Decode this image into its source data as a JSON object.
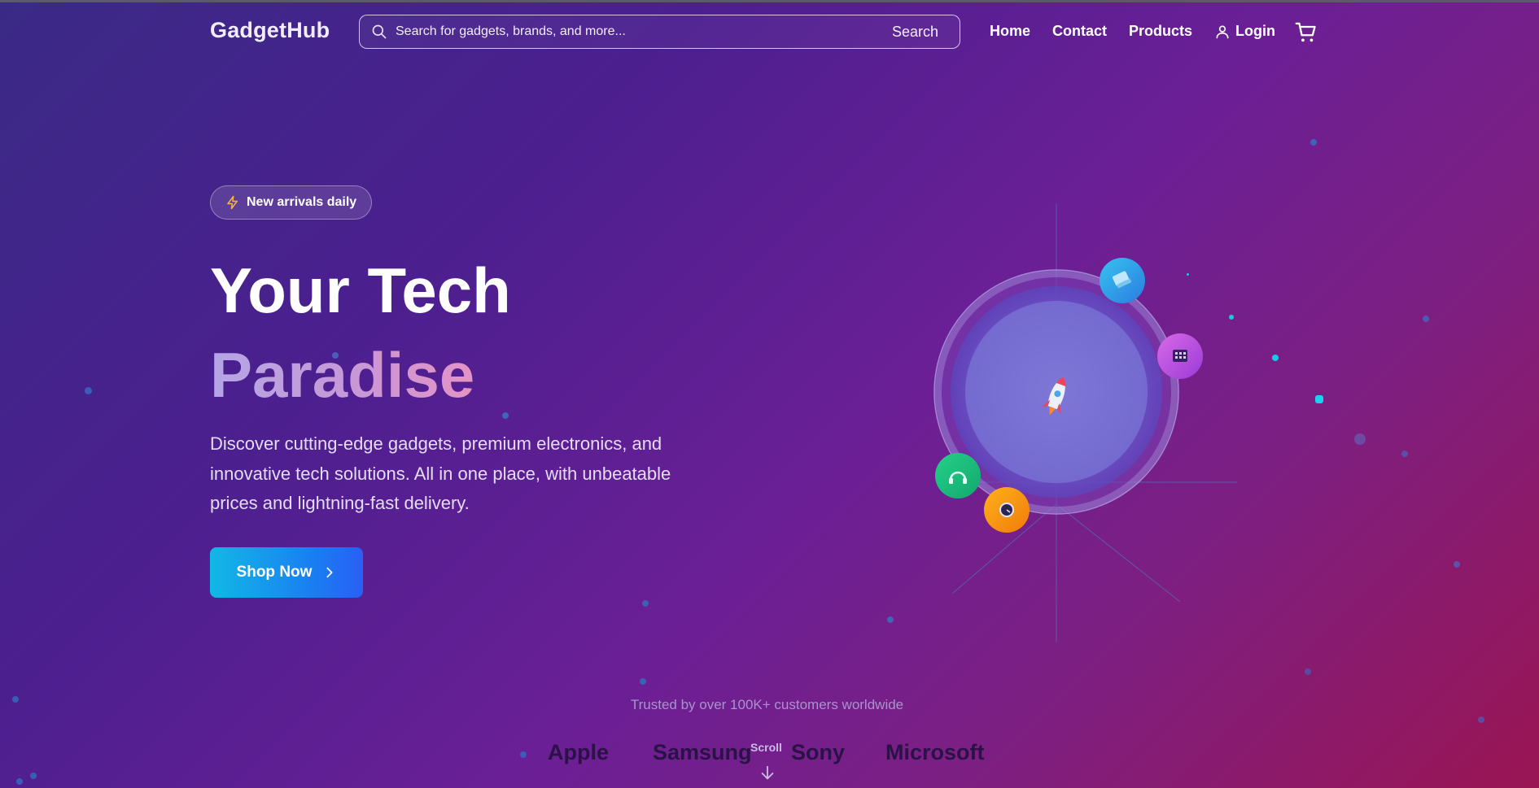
{
  "nav": {
    "logo": "GadgetHub",
    "search_placeholder": "Search for gadgets, brands, and more...",
    "search_button": "Search",
    "links": [
      "Home",
      "Contact",
      "Products"
    ],
    "login": "Login"
  },
  "hero": {
    "badge": "New arrivals daily",
    "title_line1": "Your Tech",
    "title_line2": "Paradise",
    "description": "Discover cutting-edge gadgets, premium electronics, and innovative tech solutions. All in one place, with unbeatable prices and lightning-fast delivery.",
    "cta": "Shop Now"
  },
  "trusted": {
    "text": "Trusted by over 100K+ customers worldwide",
    "brands": [
      "Apple",
      "Samsung",
      "Sony",
      "Microsoft"
    ],
    "scroll_label": "Scroll"
  },
  "icons": {
    "search": "search-icon",
    "user": "user-icon",
    "cart": "cart-icon",
    "bolt": "lightning-icon",
    "chevron": "chevron-right-icon",
    "scroll": "arrow-down-icon"
  },
  "colors": {
    "bg_start": "#3a2a86",
    "bg_end": "#9a1553",
    "cta_start": "#12b8e6",
    "cta_end": "#2a5ff5",
    "badge_bolt": "#f5b73b"
  }
}
